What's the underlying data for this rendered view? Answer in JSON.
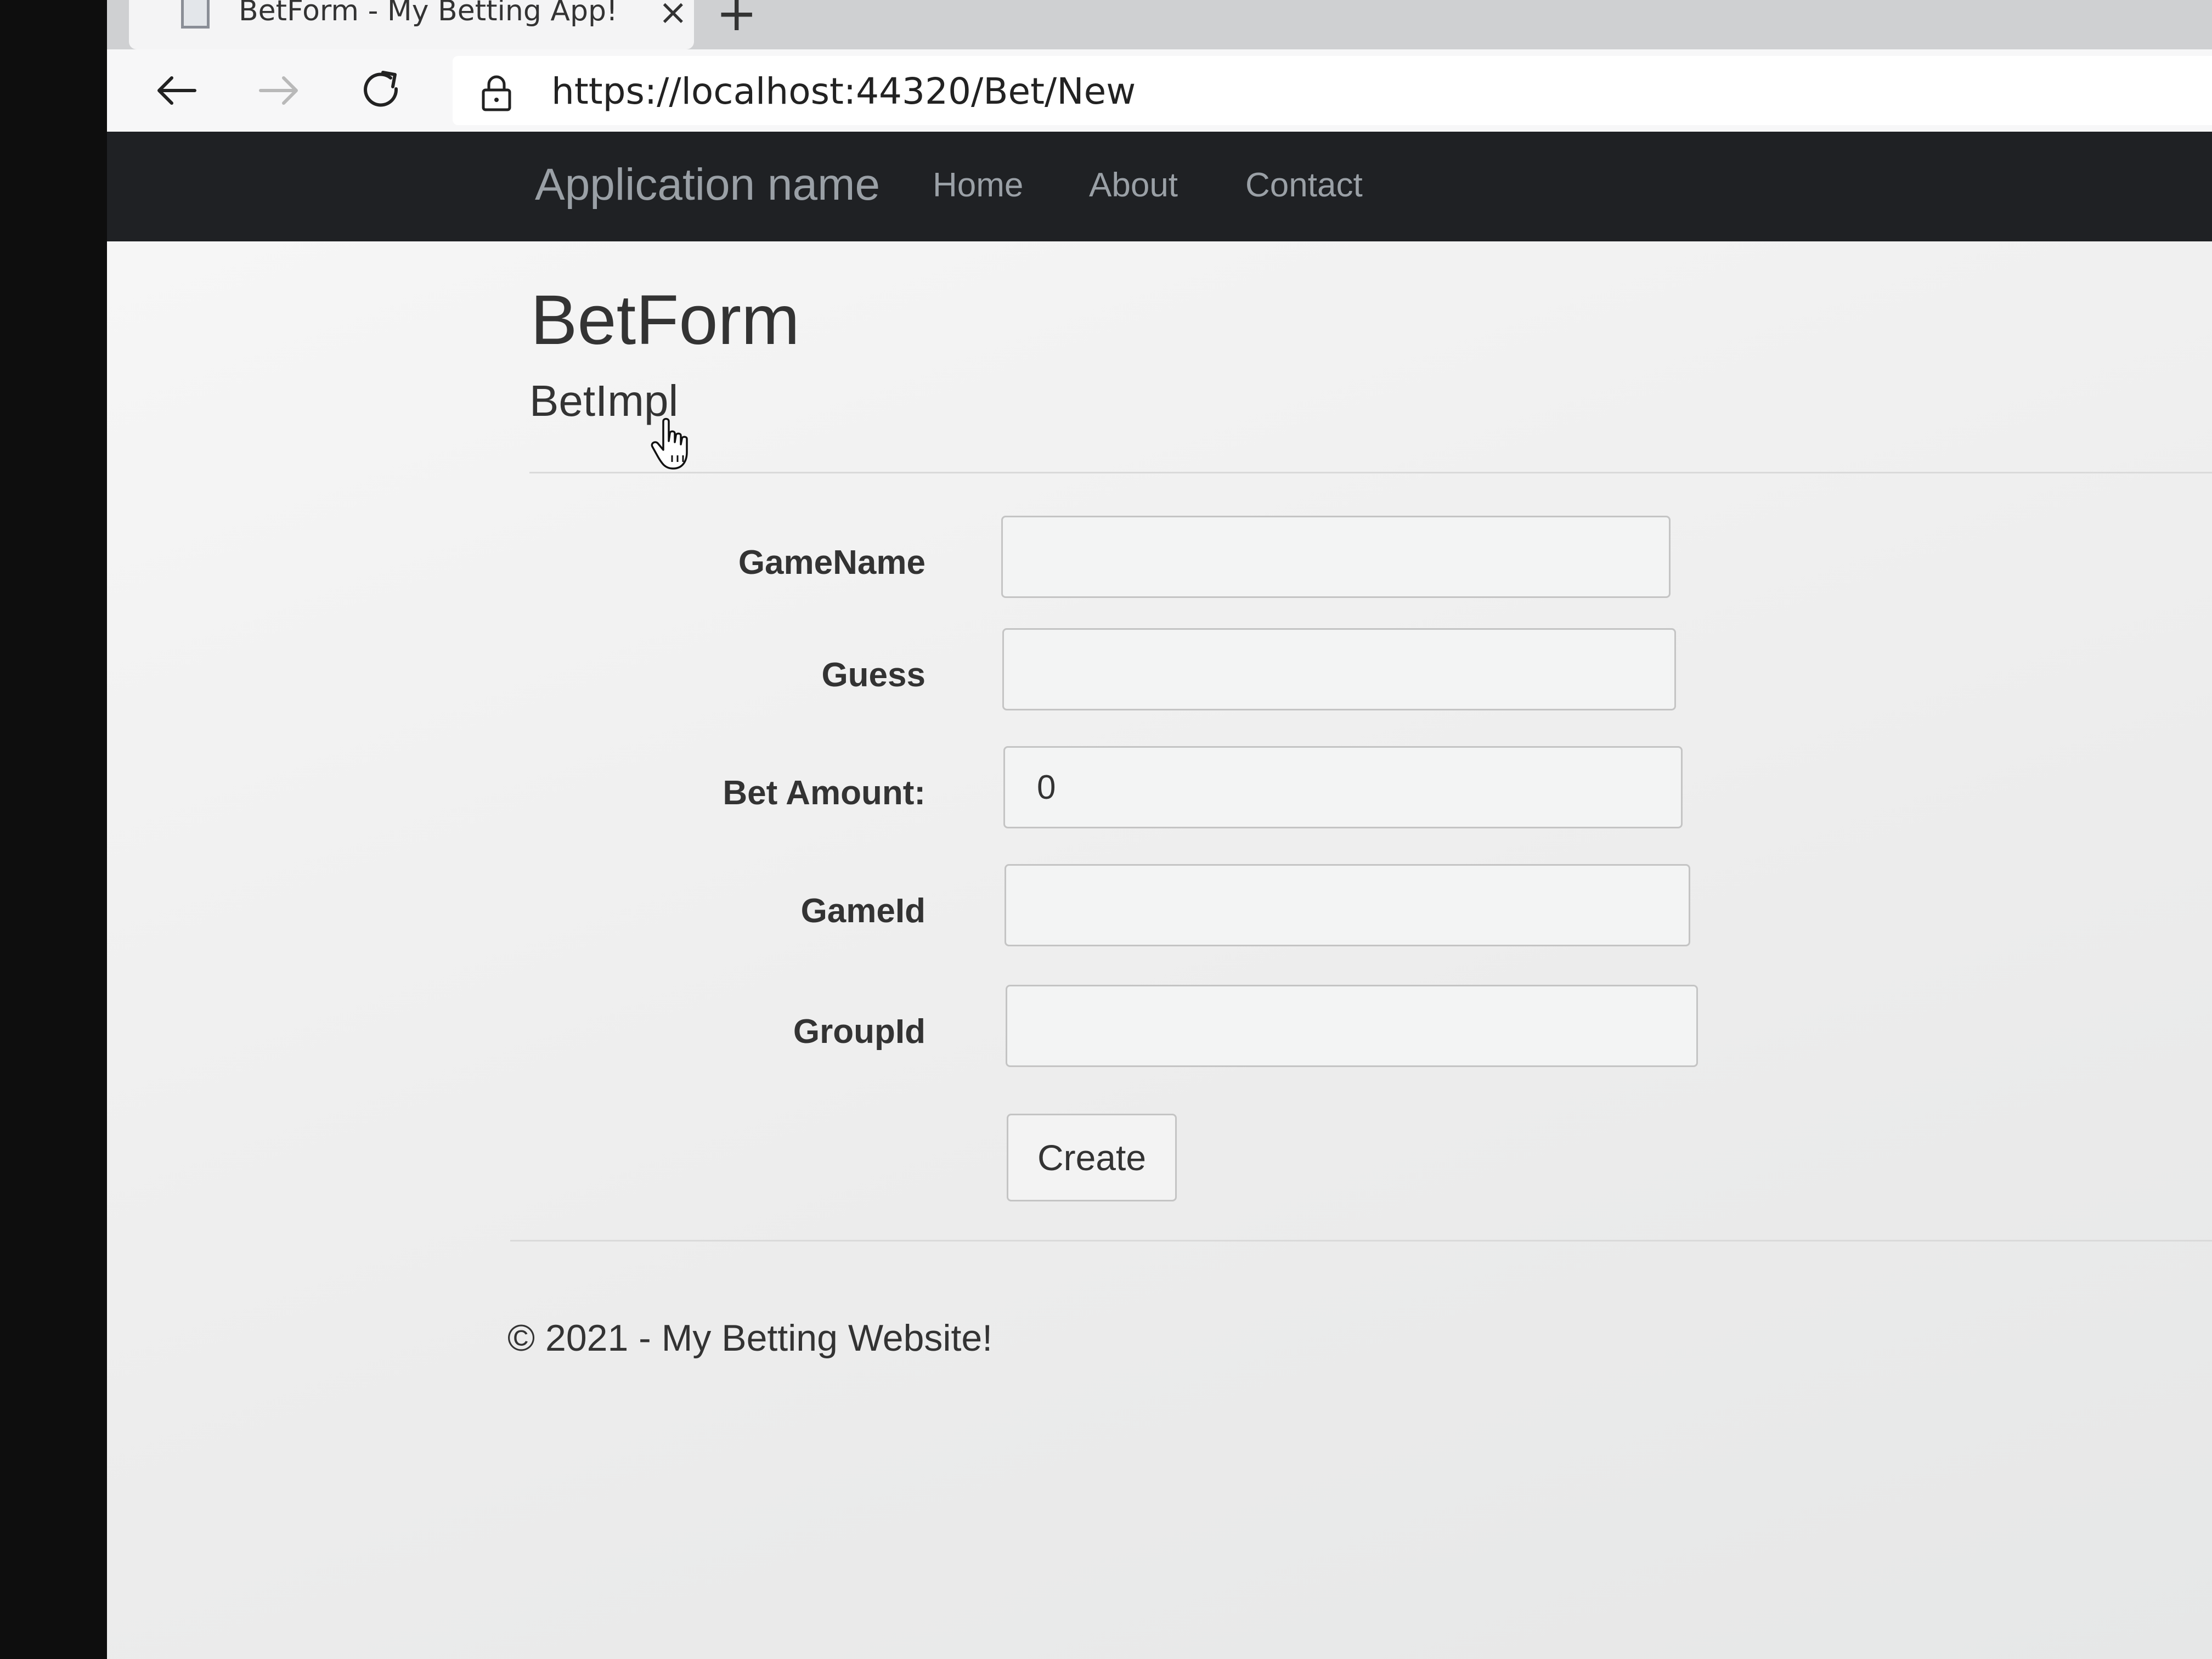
{
  "browser": {
    "tab_title": "BetForm - My Betting App!",
    "tab_close_glyph": "×",
    "new_tab_glyph": "+",
    "url": "https://localhost:44320/Bet/New",
    "icons": [
      "back-arrow-icon",
      "forward-arrow-icon",
      "reload-icon",
      "lock-icon",
      "page-favicon-icon"
    ]
  },
  "navbar": {
    "brand": "Application name",
    "links": [
      "Home",
      "About",
      "Contact"
    ],
    "background": "#1f2124"
  },
  "page": {
    "title": "BetForm",
    "subtitle": "BetImpl"
  },
  "form": {
    "fields": [
      {
        "label": "GameName",
        "value": ""
      },
      {
        "label": "Guess",
        "value": ""
      },
      {
        "label": "Bet Amount:",
        "value": "0"
      },
      {
        "label": "GameId",
        "value": ""
      },
      {
        "label": "GroupId",
        "value": ""
      }
    ],
    "submit_label": "Create"
  },
  "footer": {
    "text": "© 2021 - My Betting Website!"
  }
}
